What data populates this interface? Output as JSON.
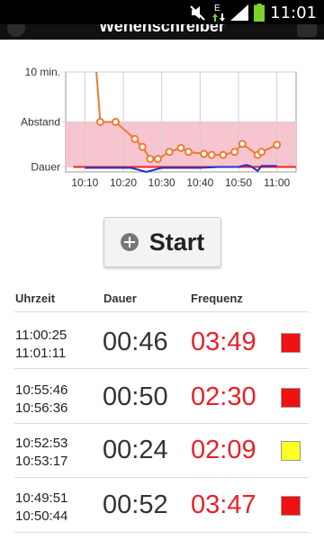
{
  "status_bar": {
    "time": "11:01",
    "network": "E",
    "icons": [
      "mute-icon",
      "data-arrows-icon",
      "signal-icon",
      "battery-icon"
    ]
  },
  "app": {
    "title": "Wehenschreiber"
  },
  "chart_data": {
    "type": "line",
    "y_tick_labels": [
      "10 min.",
      "Abstand",
      "Dauer"
    ],
    "x_tick_labels": [
      "10:10",
      "10:20",
      "10:30",
      "10:40",
      "10:50",
      "11:00"
    ],
    "x_range": [
      "10:05",
      "11:05"
    ],
    "y_range_minutes": [
      0,
      10
    ],
    "grid": true,
    "target_band_minutes": [
      0.5,
      5
    ],
    "series": [
      {
        "color": "#f07a30",
        "x": [
          "10:13",
          "10:14",
          "10:18",
          "10:23",
          "10:25",
          "10:27",
          "10:29",
          "10:32",
          "10:35",
          "10:37",
          "10:41",
          "10:43",
          "10:46",
          "10:49",
          "10:51",
          "10:55",
          "10:56",
          "11:00"
        ],
        "y": [
          10,
          5,
          5,
          3.3,
          2.5,
          1.3,
          1.3,
          2.0,
          2.4,
          2.0,
          1.8,
          1.7,
          1.7,
          2.0,
          2.8,
          1.7,
          2.0,
          2.7
        ]
      },
      {
        "color": "#2233cc",
        "x": [
          "10:10",
          "10:13",
          "10:22",
          "10:26",
          "10:30",
          "10:34",
          "10:40",
          "10:45",
          "10:50",
          "10:52",
          "10:53",
          "10:55",
          "10:56",
          "11:00"
        ],
        "y": [
          0.4,
          0.4,
          0.4,
          0.0,
          0.4,
          0.4,
          0.4,
          0.5,
          0.5,
          0.7,
          0.6,
          0.1,
          0.6,
          0.6
        ]
      },
      {
        "color": "#ee2222",
        "x": [
          "10:07",
          "11:05"
        ],
        "y": [
          0.5,
          0.5
        ]
      }
    ],
    "band_color": "#f6c5cf"
  },
  "start_button": {
    "label": "Start",
    "icon": "plus-circle-icon"
  },
  "table": {
    "headers": {
      "time": "Uhrzeit",
      "duration": "Dauer",
      "frequency": "Frequenz"
    },
    "rows": [
      {
        "start": "11:00:25",
        "end": "11:01:11",
        "duration": "00:46",
        "frequency": "03:49",
        "swatch": "#ee1111"
      },
      {
        "start": "10:55:46",
        "end": "10:56:36",
        "duration": "00:50",
        "frequency": "02:30",
        "swatch": "#ee1111"
      },
      {
        "start": "10:52:53",
        "end": "10:53:17",
        "duration": "00:24",
        "frequency": "02:09",
        "swatch": "#ffff22"
      },
      {
        "start": "10:49:51",
        "end": "10:50:44",
        "duration": "00:52",
        "frequency": "03:47",
        "swatch": "#ee1111"
      }
    ]
  }
}
